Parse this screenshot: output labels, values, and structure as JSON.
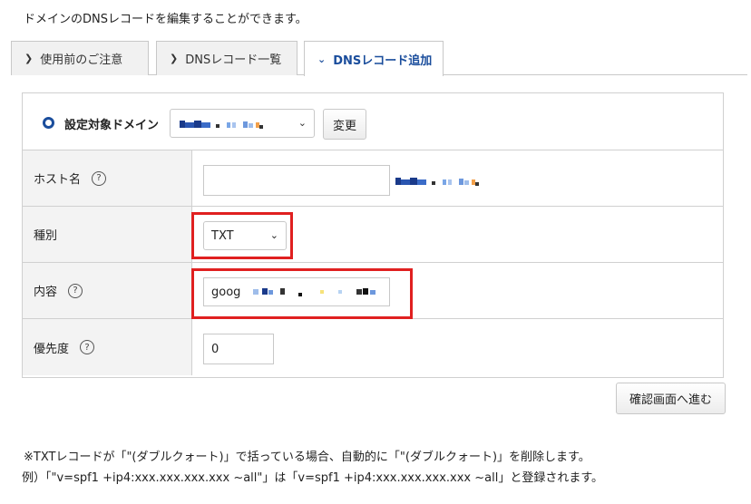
{
  "intro": "ドメインのDNSレコードを編集することができます。",
  "tabs": [
    {
      "label": "使用前のご注意",
      "active": false
    },
    {
      "label": "DNSレコード一覧",
      "active": false
    },
    {
      "label": "DNSレコード追加",
      "active": true
    }
  ],
  "form": {
    "domain_label": "設定対象ドメイン",
    "change_button": "変更",
    "host_label": "ホスト名",
    "type_label": "種別",
    "type_value": "TXT",
    "content_label": "内容",
    "content_value": "goog",
    "priority_label": "優先度",
    "priority_value": "0",
    "help_glyph": "?"
  },
  "confirm_button": "確認画面へ進む",
  "notes": {
    "line1": "※TXTレコードが「\"(ダブルクォート)」で括っている場合、自動的に「\"(ダブルクォート)」を削除します。",
    "line2": "例）「\"v=spf1 +ip4:xxx.xxx.xxx.xxx ~all\"」は「v=spf1 +ip4:xxx.xxx.xxx.xxx ~all」と登録されます。"
  },
  "colors": {
    "accent": "#1a4d9c",
    "highlight": "#e02020",
    "label_bg": "#f3f3f3"
  },
  "icons": {
    "tab_chevron": "chevron-right-icon",
    "active_tab_chevron": "chevron-down-icon",
    "select_chevron": "chevron-down-icon",
    "domain_marker": "ring-icon",
    "help": "question-circle-icon"
  }
}
